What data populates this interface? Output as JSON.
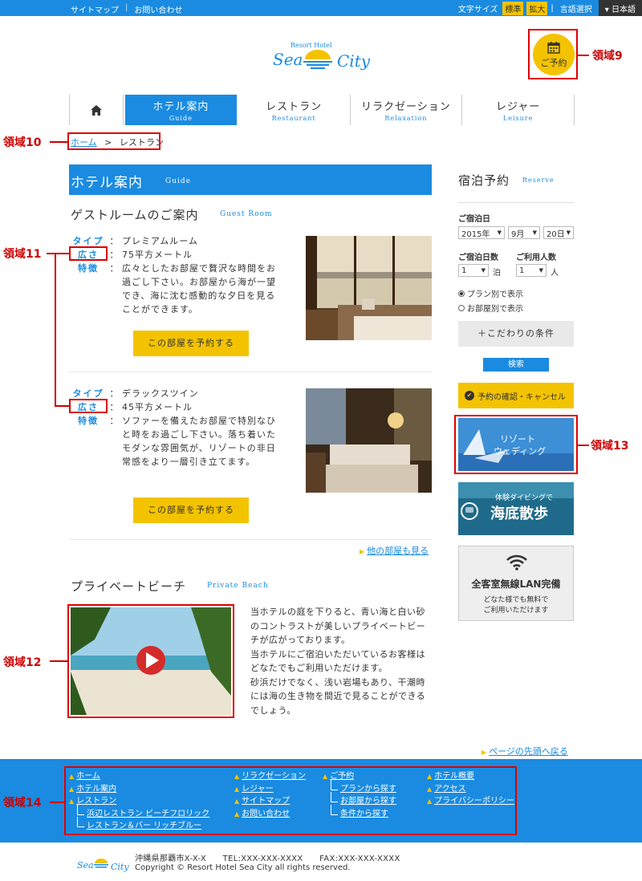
{
  "topbar": {
    "sitemap": "サイトマップ",
    "contact": "お問い合わせ",
    "font_size_label": "文字サイズ",
    "font_standard": "標準",
    "font_large": "拡大",
    "lang_label": "言語選択",
    "lang_value": "日本語"
  },
  "logo": {
    "arc": "Resort Hotel",
    "sea": "Sea",
    "city": "City"
  },
  "reserve_button": "ご予約",
  "nav": {
    "items": [
      {
        "jp": "ホテル案内",
        "en": "Guide"
      },
      {
        "jp": "レストラン",
        "en": "Restaurant"
      },
      {
        "jp": "リラクゼーション",
        "en": "Relaxation"
      },
      {
        "jp": "レジャー",
        "en": "Leisure"
      }
    ]
  },
  "breadcrumb": {
    "home": "ホーム",
    "sep": ">",
    "current": "レストラン"
  },
  "section": {
    "jp": "ホテル案内",
    "en": "Guide"
  },
  "guest_room": {
    "title": "ゲストルームのご案内",
    "en": "Guest Room"
  },
  "labels": {
    "type": "タイプ",
    "size": "広さ",
    "feature": "特徴",
    "colon": "："
  },
  "rooms": [
    {
      "type": "プレミアムルーム",
      "size": "75平方メートル",
      "feature_lines": [
        "広々としたお部屋で贅沢な時間をお",
        "過ごし下さい。お部屋から海が一望",
        "でき、海に沈む感動的な夕日を見る",
        "ことができます。"
      ],
      "book": "この部屋を予約する"
    },
    {
      "type": "デラックスツイン",
      "size": "45平方メートル",
      "feature_lines": [
        "ソファーを備えたお部屋で特別なひ",
        "と時をお過ごし下さい。落ち着いた",
        "モダンな雰囲気が、リゾートの非日",
        "常感をより一層引き立てます。"
      ],
      "book": "この部屋を予約する"
    }
  ],
  "more_rooms": "他の部屋も見る",
  "beach": {
    "title": "プライベートビーチ",
    "en": "Private Beach",
    "lines": [
      "当ホテルの庭を下りると、青い海と白い砂",
      "のコントラストが美しいプライベートビー",
      "チが広がっております。",
      "当ホテルにご宿泊いただいているお客様は",
      "どなたでもご利用いただけます。",
      "砂浜だけでなく、浅い岩場もあり、干潮時",
      "には海の生き物を間近で見ることができる",
      "でしょう。"
    ]
  },
  "sidebar": {
    "title": "宿泊予約",
    "en": "Reserve",
    "date_label": "ご宿泊日",
    "year": "2015年",
    "month": "9月",
    "day": "20日",
    "nights_label": "ご宿泊日数",
    "nights": "1",
    "nights_unit": "泊",
    "guests_label": "ご利用人数",
    "guests": "1",
    "guests_unit": "人",
    "radio_plan": "プラン別で表示",
    "radio_room": "お部屋別で表示",
    "conditions": "＋こだわりの条件",
    "search": "検索",
    "confirm": "予約の確認・キャンセル",
    "banner_wedding": "リゾートウェディング",
    "banner_wedding_l1": "リゾート",
    "banner_wedding_l2": "ウェディング",
    "banner_diving_small": "体験ダイビングで",
    "banner_diving_big": "海底散歩",
    "wifi_title": "全客室無線LAN完備",
    "wifi_l1": "どなた様でも無料で",
    "wifi_l2": "ご利用いただけます"
  },
  "page_top": "ページの先頭へ戻る",
  "annotations": {
    "r9": "領域9",
    "r10": "領域10",
    "r11": "領域11",
    "r12": "領域12",
    "r13": "領域13",
    "r14": "領域14"
  },
  "footer": {
    "col1": {
      "home": "ホーム",
      "guide": "ホテル案内",
      "restaurant": "レストラン",
      "sub1": "浜辺レストラン ビーチフロリック",
      "sub2": "レストラン＆バー リッチブルー"
    },
    "col2": {
      "relax": "リラクゼーション",
      "leisure": "レジャー",
      "sitemap": "サイトマップ",
      "contact": "お問い合わせ"
    },
    "col3": {
      "reserve": "ご予約",
      "plan": "プランから探す",
      "room": "お部屋から探す",
      "cond": "条件から探す"
    },
    "col4": {
      "about": "ホテル概要",
      "access": "アクセス",
      "privacy": "プライバシーポリシー"
    },
    "address": "沖縄県那覇市X-X-X　　TEL:XXX-XXX-XXXX　　FAX:XXX-XXX-XXXX",
    "copyright": "Copyright © Resort Hotel Sea City all rights reserved."
  },
  "colors": {
    "brand_blue": "#1a8be0",
    "accent_yellow": "#f4c300",
    "annotation_red": "#d00000"
  }
}
